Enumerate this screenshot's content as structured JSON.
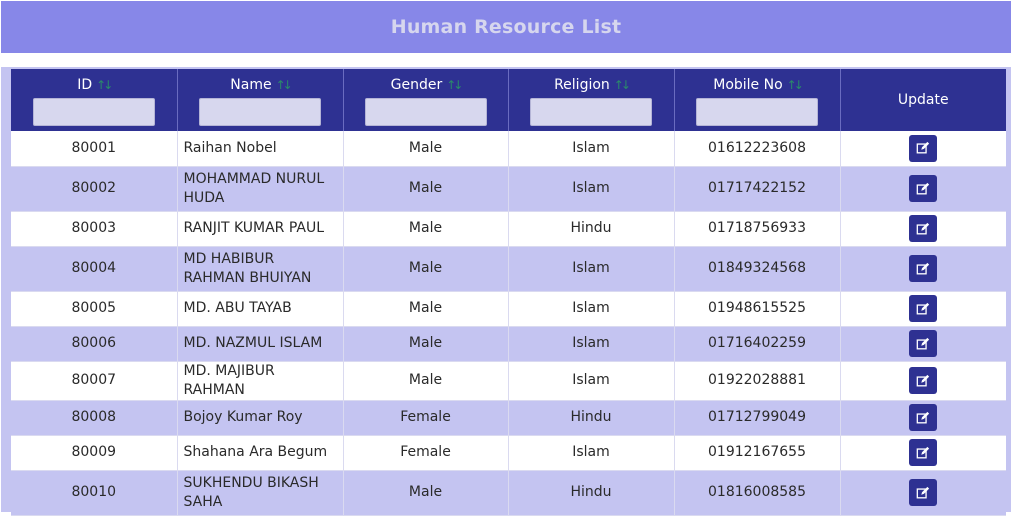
{
  "header": {
    "title": "Human Resource List"
  },
  "table": {
    "columns": [
      {
        "label": "ID",
        "sortable": true,
        "filter": ""
      },
      {
        "label": "Name",
        "sortable": true,
        "filter": ""
      },
      {
        "label": "Gender",
        "sortable": true,
        "filter": ""
      },
      {
        "label": "Religion",
        "sortable": true,
        "filter": ""
      },
      {
        "label": "Mobile No",
        "sortable": true,
        "filter": ""
      },
      {
        "label": "Update",
        "sortable": false
      }
    ],
    "sort_icon": "sort-arrows-icon",
    "edit_icon": "edit-icon",
    "rows": [
      {
        "id": "80001",
        "name": "Raihan Nobel",
        "gender": "Male",
        "religion": "Islam",
        "mobile": "01612223608"
      },
      {
        "id": "80002",
        "name": "MOHAMMAD NURUL HUDA",
        "gender": "Male",
        "religion": "Islam",
        "mobile": "01717422152"
      },
      {
        "id": "80003",
        "name": "RANJIT KUMAR PAUL",
        "gender": "Male",
        "religion": "Hindu",
        "mobile": "01718756933"
      },
      {
        "id": "80004",
        "name": "MD HABIBUR RAHMAN BHUIYAN",
        "gender": "Male",
        "religion": "Islam",
        "mobile": "01849324568"
      },
      {
        "id": "80005",
        "name": "MD. ABU TAYAB",
        "gender": "Male",
        "religion": "Islam",
        "mobile": "01948615525"
      },
      {
        "id": "80006",
        "name": "MD. NAZMUL ISLAM",
        "gender": "Male",
        "religion": "Islam",
        "mobile": "01716402259"
      },
      {
        "id": "80007",
        "name": "MD. MAJIBUR RAHMAN",
        "gender": "Male",
        "religion": "Islam",
        "mobile": "01922028881"
      },
      {
        "id": "80008",
        "name": "Bojoy Kumar Roy",
        "gender": "Female",
        "religion": "Hindu",
        "mobile": "01712799049"
      },
      {
        "id": "80009",
        "name": "Shahana Ara Begum",
        "gender": "Female",
        "religion": "Islam",
        "mobile": "01912167655"
      },
      {
        "id": "80010",
        "name": "SUKHENDU BIKASH SAHA",
        "gender": "Male",
        "religion": "Hindu",
        "mobile": "01816008585"
      }
    ]
  },
  "colors": {
    "header_bg": "#8787e8",
    "table_head_bg": "#2e3192",
    "row_alt_bg": "#c4c4f1",
    "sort_icon": "#2a8a6a"
  }
}
